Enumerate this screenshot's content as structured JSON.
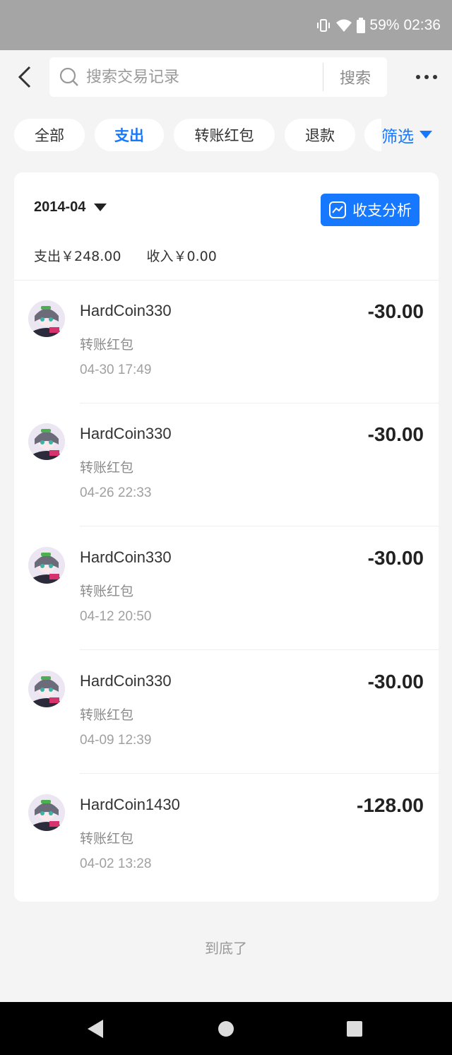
{
  "status_bar": {
    "battery": "59%",
    "time": "02:36"
  },
  "search": {
    "placeholder": "搜索交易记录",
    "button_label": "搜索"
  },
  "chips": [
    {
      "label": "全部"
    },
    {
      "label": "支出"
    },
    {
      "label": "转账红包"
    },
    {
      "label": "退款"
    }
  ],
  "filter": {
    "label": "筛选"
  },
  "month": {
    "value": "2014-04"
  },
  "analysis": {
    "label": "收支分析"
  },
  "summary": {
    "expense": "支出￥248.00",
    "income": "收入￥0.00"
  },
  "transactions": [
    {
      "name": "HardCoin330",
      "type": "转账红包",
      "time": "04-30 17:49",
      "amount": "-30.00"
    },
    {
      "name": "HardCoin330",
      "type": "转账红包",
      "time": "04-26 22:33",
      "amount": "-30.00"
    },
    {
      "name": "HardCoin330",
      "type": "转账红包",
      "time": "04-12 20:50",
      "amount": "-30.00"
    },
    {
      "name": "HardCoin330",
      "type": "转账红包",
      "time": "04-09 12:39",
      "amount": "-30.00"
    },
    {
      "name": "HardCoin1430",
      "type": "转账红包",
      "time": "04-02 13:28",
      "amount": "-128.00"
    }
  ],
  "footer": {
    "end_text": "到底了"
  },
  "colors": {
    "accent": "#1677ff",
    "background": "#f4f4f4",
    "status_bar": "#a5a5a5"
  }
}
